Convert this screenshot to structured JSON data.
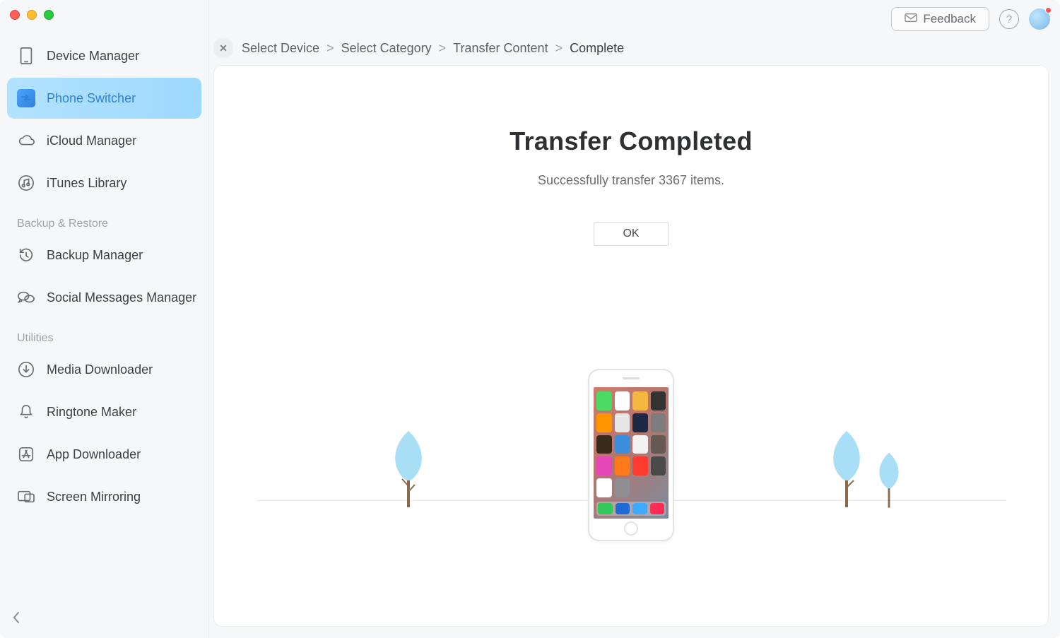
{
  "header": {
    "feedback_label": "Feedback",
    "help_label": "?"
  },
  "sidebar": {
    "items": [
      {
        "label": "Device Manager"
      },
      {
        "label": "Phone Switcher"
      },
      {
        "label": "iCloud Manager"
      },
      {
        "label": "iTunes Library"
      }
    ],
    "section_backup_label": "Backup & Restore",
    "backup_items": [
      {
        "label": "Backup Manager"
      },
      {
        "label": "Social Messages Manager"
      }
    ],
    "section_utilities_label": "Utilities",
    "utility_items": [
      {
        "label": "Media Downloader"
      },
      {
        "label": "Ringtone Maker"
      },
      {
        "label": "App Downloader"
      },
      {
        "label": "Screen Mirroring"
      }
    ]
  },
  "breadcrumbs": {
    "items": [
      {
        "label": "Select Device"
      },
      {
        "label": "Select Category"
      },
      {
        "label": "Transfer Content"
      },
      {
        "label": "Complete"
      }
    ]
  },
  "main": {
    "title": "Transfer Completed",
    "subtitle": "Successfully transfer 3367 items.",
    "ok_label": "OK"
  },
  "colors": {
    "accent": "#2f82d8",
    "tree": "#a9def7",
    "trunk": "#8a6a4a"
  }
}
